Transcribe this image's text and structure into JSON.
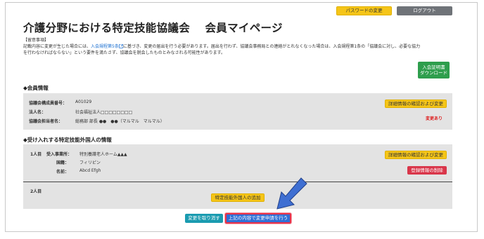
{
  "header": {
    "password_button": "パスワードの変更",
    "logout_button": "ログアウト",
    "title": "介護分野における特定技能協議会　 会員マイページ"
  },
  "notice": {
    "heading": "【留意事項】",
    "line1_prefix": "記載内容に変更が生じた場合には、",
    "line1_link": "入会規程第5条",
    "line1_suffix": "に基づき、変更の届出を行う必要があります。届出を行わず、協議会事務局との連絡がとれなくなった場合は、入会規程第1条の「協議会に対し、必要な協力",
    "line2": "を行わなければならない」という要件を満たさず、協議会を脱会したものとみなされる可能性があります。"
  },
  "certificate_button": {
    "line1": "入会証明書",
    "line2": "ダウンロード"
  },
  "member_info": {
    "heading": "◆会員情報",
    "rows": [
      {
        "label": "協議会構成員番号：",
        "value": "A01029"
      },
      {
        "label": "法人名：",
        "value": "社会福祉法人□□□□□□□□"
      },
      {
        "label": "協議会担当者名：",
        "value": "総務部 部長 ●●　●●（マルマル　マルマル）"
      }
    ],
    "detail_button": "詳細情報の確認および変更",
    "change_badge": "変更あり"
  },
  "foreign_info": {
    "heading": "◆受け入れする特定技能外国人の情報",
    "person1": {
      "index": "1人目",
      "rows": [
        {
          "label": "受入事業所：",
          "value": "特別養護老人ホーム▲▲▲"
        },
        {
          "label": "国籍：",
          "value": "フィリピン"
        },
        {
          "label": "名前：",
          "value": "Abcd Efgh"
        }
      ],
      "detail_button": "詳細情報の確認および変更",
      "delete_button": "登録情報の削除"
    },
    "person2": {
      "index": "2人目",
      "add_button": "特定技能外国人の追加"
    }
  },
  "footer": {
    "cancel_button": "変更を取り消す",
    "submit_button": "上記の内容で変更申請を行う"
  },
  "colors": {
    "yellow": "#f5c518",
    "gray": "#6f7378",
    "green": "#2e9e4d",
    "red": "#d9364a",
    "teal": "#1a9bb0",
    "blue": "#2f6fd6",
    "panel": "#e3e3e3"
  }
}
